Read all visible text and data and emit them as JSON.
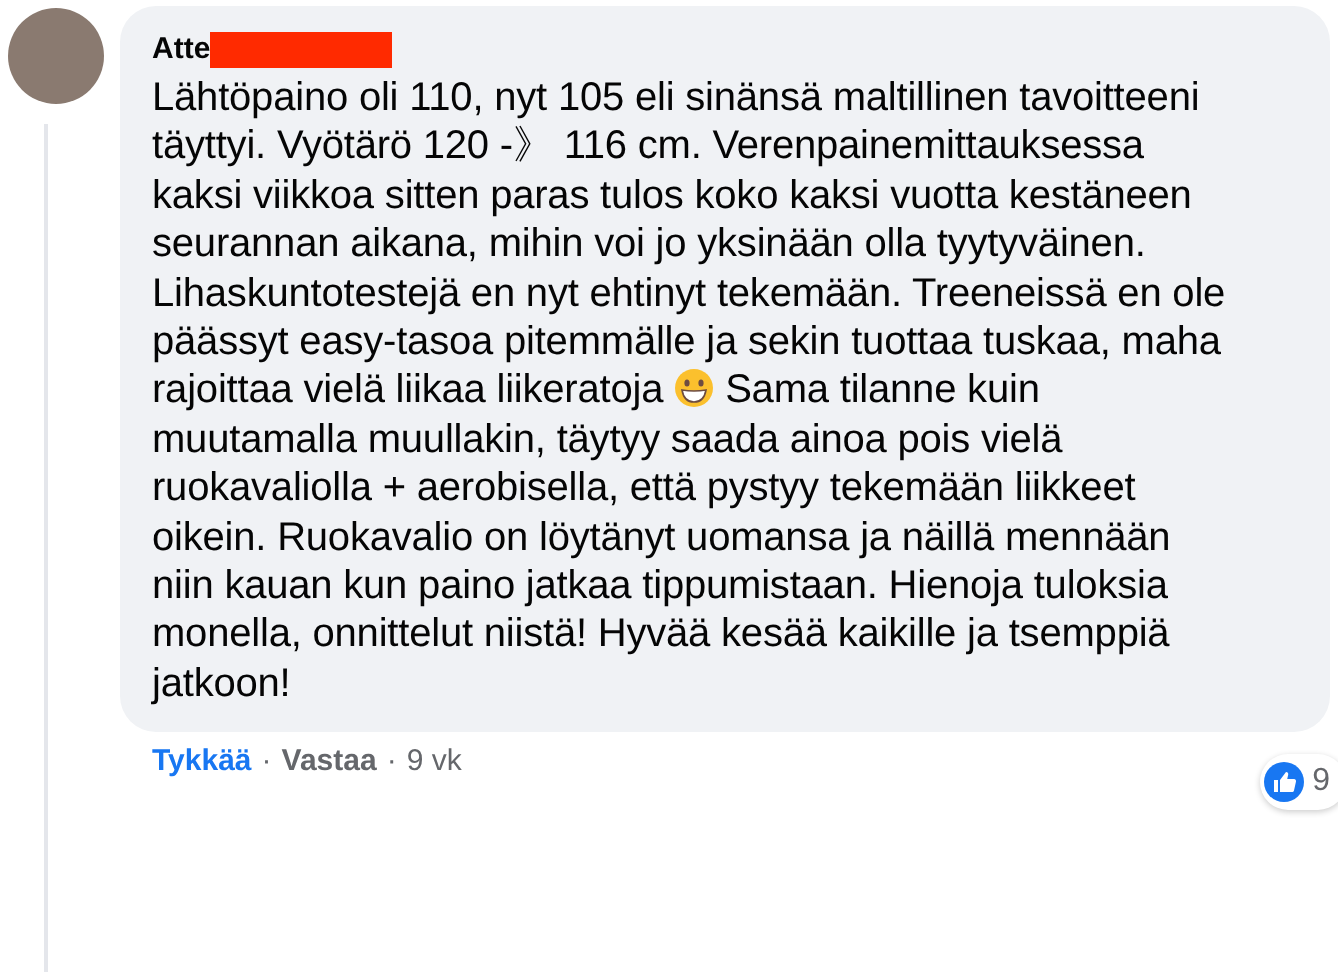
{
  "comment": {
    "author": "Atte",
    "author_redacted": true,
    "text_before_emoji": "Lähtöpaino oli 110, nyt 105 eli sinänsä maltillinen tavoitteeni täyttyi. Vyötärö 120 -》 116 cm. Verenpainemittauksessa kaksi viikkoa sitten paras tulos koko kaksi vuotta kestäneen seurannan aikana, mihin voi jo yksinään olla tyytyväinen. Lihaskuntotestejä en nyt ehtinyt tekemään. Treeneissä en ole päässyt easy-tasoa pitemmälle ja sekin tuottaa tuskaa, maha rajoittaa vielä liikaa liikeratoja",
    "text_after_emoji": "Sama tilanne kuin muutamalla muullakin, täytyy saada ainoa pois vielä ruokavaliolla + aerobisella, että pystyy tekemään liikkeet oikein. Ruokavalio on löytänyt uomansa ja näillä mennään niin kauan kun paino jatkaa tippumistaan. Hienoja tuloksia monella, onnittelut niistä! Hyvää kesää kaikille ja tsemppiä jatkoon!",
    "reaction_count": "9"
  },
  "actions": {
    "like": {
      "label": "Tykkää",
      "liked": true
    },
    "separator_1": "·",
    "reply": "Vastaa",
    "separator_2": "·",
    "time": "9 vk"
  }
}
